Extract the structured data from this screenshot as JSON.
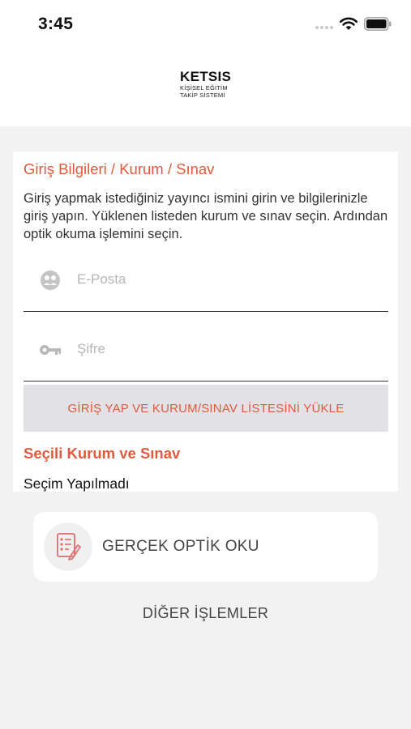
{
  "status_bar": {
    "time": "3:45",
    "wifi_icon": "wifi-icon",
    "battery_icon": "battery-icon"
  },
  "header": {
    "logo_title": "KETSIS",
    "logo_line1": "KİŞİSEL EĞİTİM",
    "logo_line2": "TAKİP SİSTEMİ"
  },
  "login": {
    "section_title": "Giriş Bilgileri / Kurum / Sınav",
    "description": "Giriş yapmak istediğiniz yayıncı ismini girin ve bilgilerinizle giriş yapın. Yüklenen listeden kurum ve sınav seçin. Ardından optik okuma işlemini seçin.",
    "email": {
      "placeholder": "E-Posta",
      "value": "",
      "icon": "user-circle-icon"
    },
    "password": {
      "placeholder": "Şifre",
      "value": "",
      "icon": "key-icon"
    },
    "submit_label": "GİRİŞ YAP VE KURUM/SINAV LİSTESİNİ YÜKLE"
  },
  "selection": {
    "section_title": "Seçili Kurum ve Sınav",
    "value": "Seçim Yapılmadı"
  },
  "actions": {
    "optic_read_label": "GERÇEK OPTİK OKU",
    "optic_read_icon": "optical-form-icon",
    "other_label": "DİĞER İŞLEMLER"
  },
  "colors": {
    "accent": "#e05a3c",
    "background": "#f2f2f2",
    "button_bg": "#e1e1e6"
  }
}
